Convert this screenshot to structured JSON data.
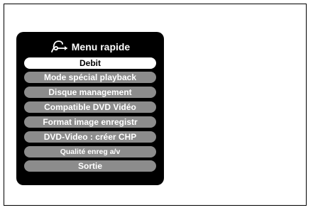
{
  "menu": {
    "title": "Menu rapide",
    "title_icon": "quick-menu-arrow-icon",
    "items": [
      {
        "label": "Debit",
        "selected": true
      },
      {
        "label": "Mode spécial playback",
        "selected": false
      },
      {
        "label": "Disque management",
        "selected": false
      },
      {
        "label": "Compatible DVD Vidéo",
        "selected": false
      },
      {
        "label": "Format image enregistr",
        "selected": false
      },
      {
        "label": "DVD-Video : créer CHP",
        "selected": false
      },
      {
        "label": "Qualité enreg a/v",
        "selected": false
      },
      {
        "label": "Sortie",
        "selected": false
      }
    ]
  },
  "colors": {
    "panel": "#000000",
    "item_background": "#8c8c8c",
    "selected_background": "#ffffff"
  }
}
